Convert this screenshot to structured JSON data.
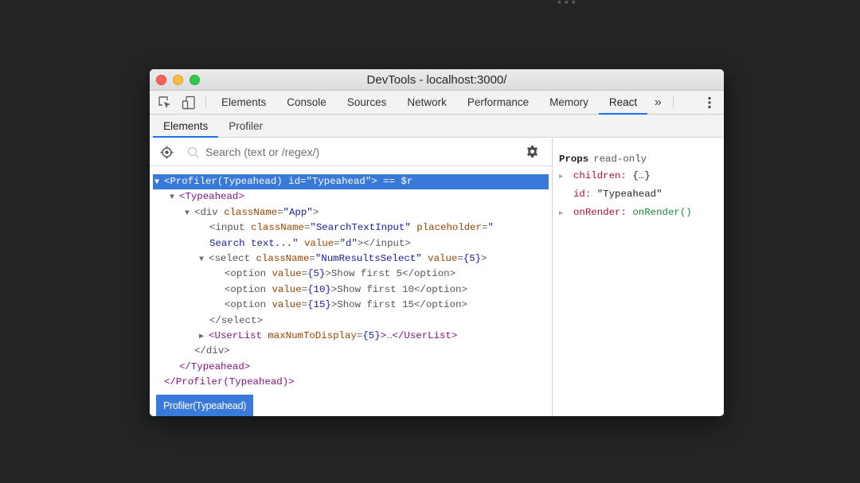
{
  "window": {
    "title": "DevTools - localhost:3000/"
  },
  "toolbar": {
    "tabs": [
      "Elements",
      "Console",
      "Sources",
      "Network",
      "Performance",
      "Memory",
      "React"
    ],
    "active_tab": "React",
    "more_label": "»"
  },
  "subtabs": {
    "items": [
      "Elements",
      "Profiler"
    ],
    "active": "Elements"
  },
  "search": {
    "placeholder": "Search (text or /regex/)"
  },
  "tree": {
    "row0": {
      "open": "<",
      "tag": "Profiler(Typeahead)",
      "attr1": "id",
      "val1": "\"Typeahead\"",
      "close": ">",
      "suffix": " == $r"
    },
    "row1": {
      "tag": "Typeahead"
    },
    "row2": {
      "tag": "div",
      "attr1": "className",
      "val1": "\"App\""
    },
    "row3": {
      "tag": "input",
      "attr1": "className",
      "val1": "\"SearchTextInput\"",
      "attr2": "placeholder",
      "val2_start": "\""
    },
    "row4": {
      "val2_end": "Search text...\"",
      "attr3": "value",
      "val3": "\"d\"",
      "close": "></input>"
    },
    "row5": {
      "tag": "select",
      "attr1": "className",
      "val1": "\"NumResultsSelect\"",
      "attr2": "value",
      "val2": "{5}"
    },
    "row6": {
      "attr": "value",
      "val": "{5}",
      "text": "Show first 5"
    },
    "row7": {
      "attr": "value",
      "val": "{10}",
      "text": "Show first 10"
    },
    "row8": {
      "attr": "value",
      "val": "{15}",
      "text": "Show first 15"
    },
    "row9": {
      "text": "</select>"
    },
    "row10": {
      "tag": "UserList",
      "attr1": "maxNumToDisplay",
      "val1": "{5}",
      "ellipsis": "…",
      "close_tag": "UserList"
    },
    "row11": {
      "text": "</div>"
    },
    "row12": {
      "tag": "Typeahead"
    },
    "row13": {
      "tag": "Profiler(Typeahead)"
    }
  },
  "breadcrumb": {
    "label": "Profiler(Typeahead)"
  },
  "props": {
    "header": "Props",
    "readonly": "read-only",
    "items": [
      {
        "key": "children",
        "value": "{…}"
      },
      {
        "key": "id",
        "value": "\"Typeahead\""
      },
      {
        "key": "onRender",
        "value": "onRender()"
      }
    ]
  }
}
